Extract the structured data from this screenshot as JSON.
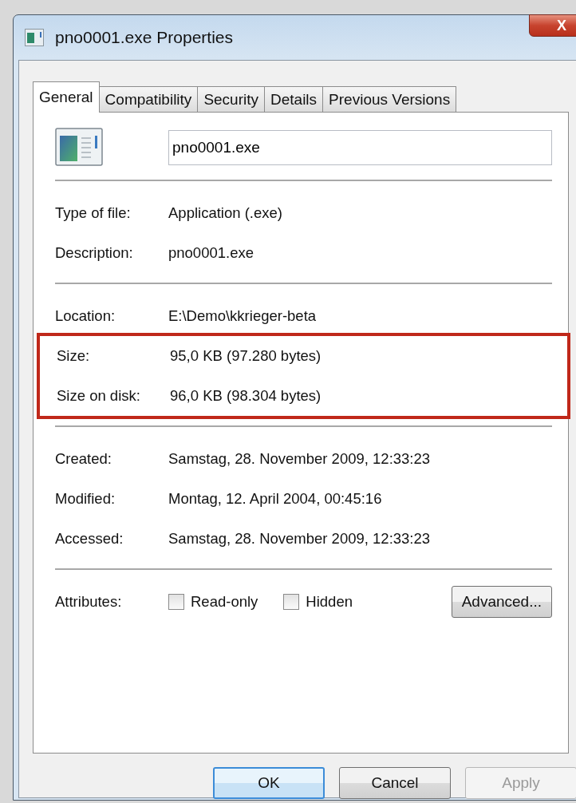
{
  "window": {
    "title": "pno0001.exe Properties",
    "close": "X"
  },
  "tabs": [
    {
      "label": "General",
      "selected": true
    },
    {
      "label": "Compatibility",
      "selected": false
    },
    {
      "label": "Security",
      "selected": false
    },
    {
      "label": "Details",
      "selected": false
    },
    {
      "label": "Previous Versions",
      "selected": false
    }
  ],
  "name_field": {
    "value": "pno0001.exe"
  },
  "sections": [
    {
      "groups": [
        {
          "highlighted": false,
          "rows": [
            {
              "label": "Type of file:",
              "value": "Application (.exe)"
            },
            {
              "label": "Description:",
              "value": "pno0001.exe"
            }
          ]
        }
      ]
    },
    {
      "groups": [
        {
          "highlighted": false,
          "rows": [
            {
              "label": "Location:",
              "value": "E:\\Demo\\kkrieger-beta"
            }
          ]
        },
        {
          "highlighted": true,
          "rows": [
            {
              "label": "Size:",
              "value": "95,0 KB (97.280 bytes)"
            },
            {
              "label": "Size on disk:",
              "value": "96,0 KB (98.304 bytes)"
            }
          ]
        }
      ]
    },
    {
      "groups": [
        {
          "highlighted": false,
          "rows": [
            {
              "label": "Created:",
              "value": "Samstag, 28. November 2009, 12:33:23"
            },
            {
              "label": "Modified:",
              "value": "Montag, 12. April 2004, 00:45:16"
            },
            {
              "label": "Accessed:",
              "value": "Samstag, 28. November 2009, 12:33:23"
            }
          ]
        }
      ]
    }
  ],
  "attributes": {
    "label": "Attributes:",
    "checkboxes": [
      {
        "label": "Read-only",
        "checked": false
      },
      {
        "label": "Hidden",
        "checked": false
      }
    ],
    "advanced": "Advanced..."
  },
  "buttons": [
    {
      "label": "OK",
      "kind": "default",
      "disabled": false
    },
    {
      "label": "Cancel",
      "kind": "normal",
      "disabled": false
    },
    {
      "label": "Apply",
      "kind": "normal",
      "disabled": true
    }
  ]
}
